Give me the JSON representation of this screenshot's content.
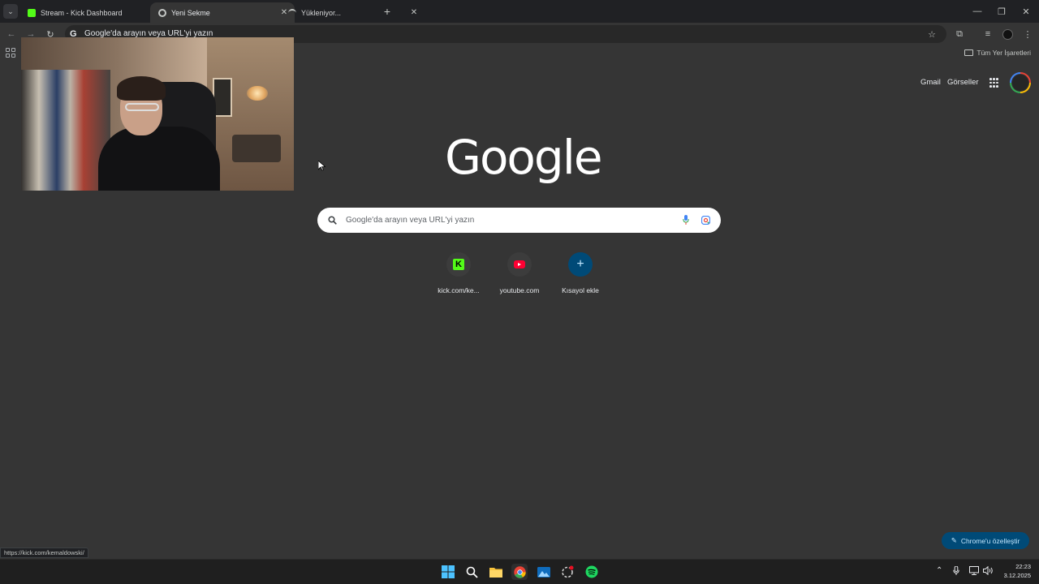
{
  "browser": {
    "tabs": [
      {
        "title": "Stream - Kick Dashboard",
        "favicon": "kick-icon",
        "active": false
      },
      {
        "title": "Yeni Sekme",
        "favicon": "chrome-icon",
        "active": true
      },
      {
        "title": "Yükleniyor...",
        "favicon": "loading-icon",
        "active": false
      }
    ],
    "omnibox_text": "Google'da arayın veya URL'yi yazın",
    "bookmarks_all_label": "Tüm Yer İşaretleri"
  },
  "page": {
    "top_links": {
      "gmail": "Gmail",
      "images": "Görseller"
    },
    "logo": "Google",
    "search_placeholder": "Google'da arayın veya URL'yi yazın",
    "shortcuts": [
      {
        "label": "kick.com/ke...",
        "icon": "kick-icon",
        "color": "#53fc18"
      },
      {
        "label": "youtube.com",
        "icon": "youtube-icon",
        "color": "#ff0033"
      },
      {
        "label": "Kısayol ekle",
        "icon": "plus-icon",
        "color": "#004a77"
      }
    ],
    "customize_label": "Chrome'u özelleştir"
  },
  "status_url": "https://kick.com/kemaldowski/",
  "taskbar": {
    "time": "22:23",
    "date": "3.12.2025"
  },
  "colors": {
    "page_bg": "#353535",
    "tabbar_bg": "#202124",
    "kick_green": "#53fc18",
    "customize_bg": "#004a77"
  }
}
